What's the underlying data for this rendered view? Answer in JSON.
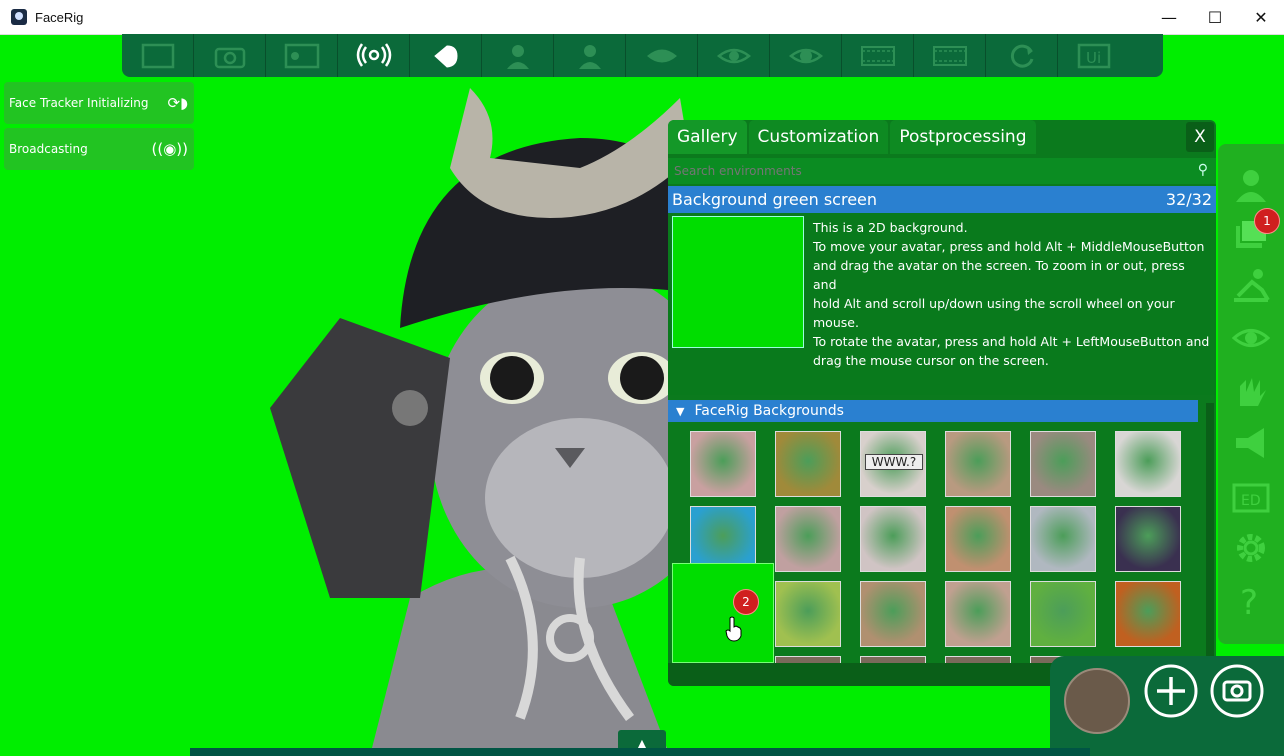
{
  "window": {
    "title": "FaceRig",
    "minimize": "—",
    "maximize": "☐",
    "close": "✕"
  },
  "toolbar": {
    "buttons": [
      "fullscreen-icon",
      "camera-icon",
      "picture-in-picture-icon",
      "broadcast-icon",
      "face-tracking-icon",
      "avatar-icon",
      "avatar-settings-icon",
      "lips-icon",
      "eye-icon",
      "eye-tracking-icon",
      "film-icon",
      "filmstrip-icon",
      "refresh-icon",
      "ui-icon"
    ],
    "active_index": 4
  },
  "left_panel": {
    "items": [
      {
        "label": "Face Tracker Initializing",
        "icon": "refresh-face-icon"
      },
      {
        "label": "Broadcasting",
        "icon": "broadcast-icon"
      }
    ]
  },
  "panel": {
    "tabs": [
      "Gallery",
      "Customization",
      "Postprocessing"
    ],
    "active_tab": "Gallery",
    "close_label": "X",
    "search_placeholder": "Search environments",
    "selected": {
      "name": "Background green screen",
      "counter": "32/32",
      "description_lines": [
        "This is a 2D background.",
        "To move your avatar, press and hold Alt + MiddleMouseButton",
        "and drag the avatar on the screen. To zoom in or out, press and",
        "hold Alt and scroll up/down using the scroll wheel on your mouse.",
        "To rotate the avatar, press and hold Alt + LeftMouseButton and",
        "drag the mouse cursor on the screen."
      ]
    },
    "section_title": "FaceRig Backgrounds",
    "thumbnails": [
      {
        "name": "bedroom-blur",
        "color": "#c9a0a0"
      },
      {
        "name": "forest-blur",
        "color": "#a08a3a"
      },
      {
        "name": "www-sign",
        "color": "#d8d0cc",
        "text": "WWW.?"
      },
      {
        "name": "hallway",
        "color": "#b89a80"
      },
      {
        "name": "street-houses",
        "color": "#9a8a80"
      },
      {
        "name": "gray-vignette",
        "color": "#d8d6d4"
      },
      {
        "name": "blue-abstract",
        "color": "#2aa0d0"
      },
      {
        "name": "crystal-ball",
        "color": "#c0a0a0"
      },
      {
        "name": "frame",
        "color": "#d0c4c4"
      },
      {
        "name": "alley",
        "color": "#c09070"
      },
      {
        "name": "winter-scene",
        "color": "#b0b8c0"
      },
      {
        "name": "night-houses",
        "color": "#3a3050"
      },
      {
        "name": "green-screen",
        "color": "#00dd00"
      },
      {
        "name": "forest-light",
        "color": "#a0c050"
      },
      {
        "name": "room-plant",
        "color": "#b09070"
      },
      {
        "name": "window-room",
        "color": "#c0a090"
      },
      {
        "name": "diamond-pattern",
        "color": "#60b040"
      },
      {
        "name": "fire-cave",
        "color": "#c06020"
      }
    ]
  },
  "right_bar": {
    "icons": [
      "avatar-icon",
      "layers-icon",
      "exercise-icon",
      "eye-settings-icon",
      "hands-icon",
      "megaphone-icon",
      "ed-icon",
      "settings-icon",
      "help-icon"
    ],
    "badge": "1"
  },
  "cursor_badge": "2",
  "colors": {
    "green_screen": "#00ee00",
    "toolbar": "#0b6a3a",
    "accent_blue": "#2a80d0"
  }
}
